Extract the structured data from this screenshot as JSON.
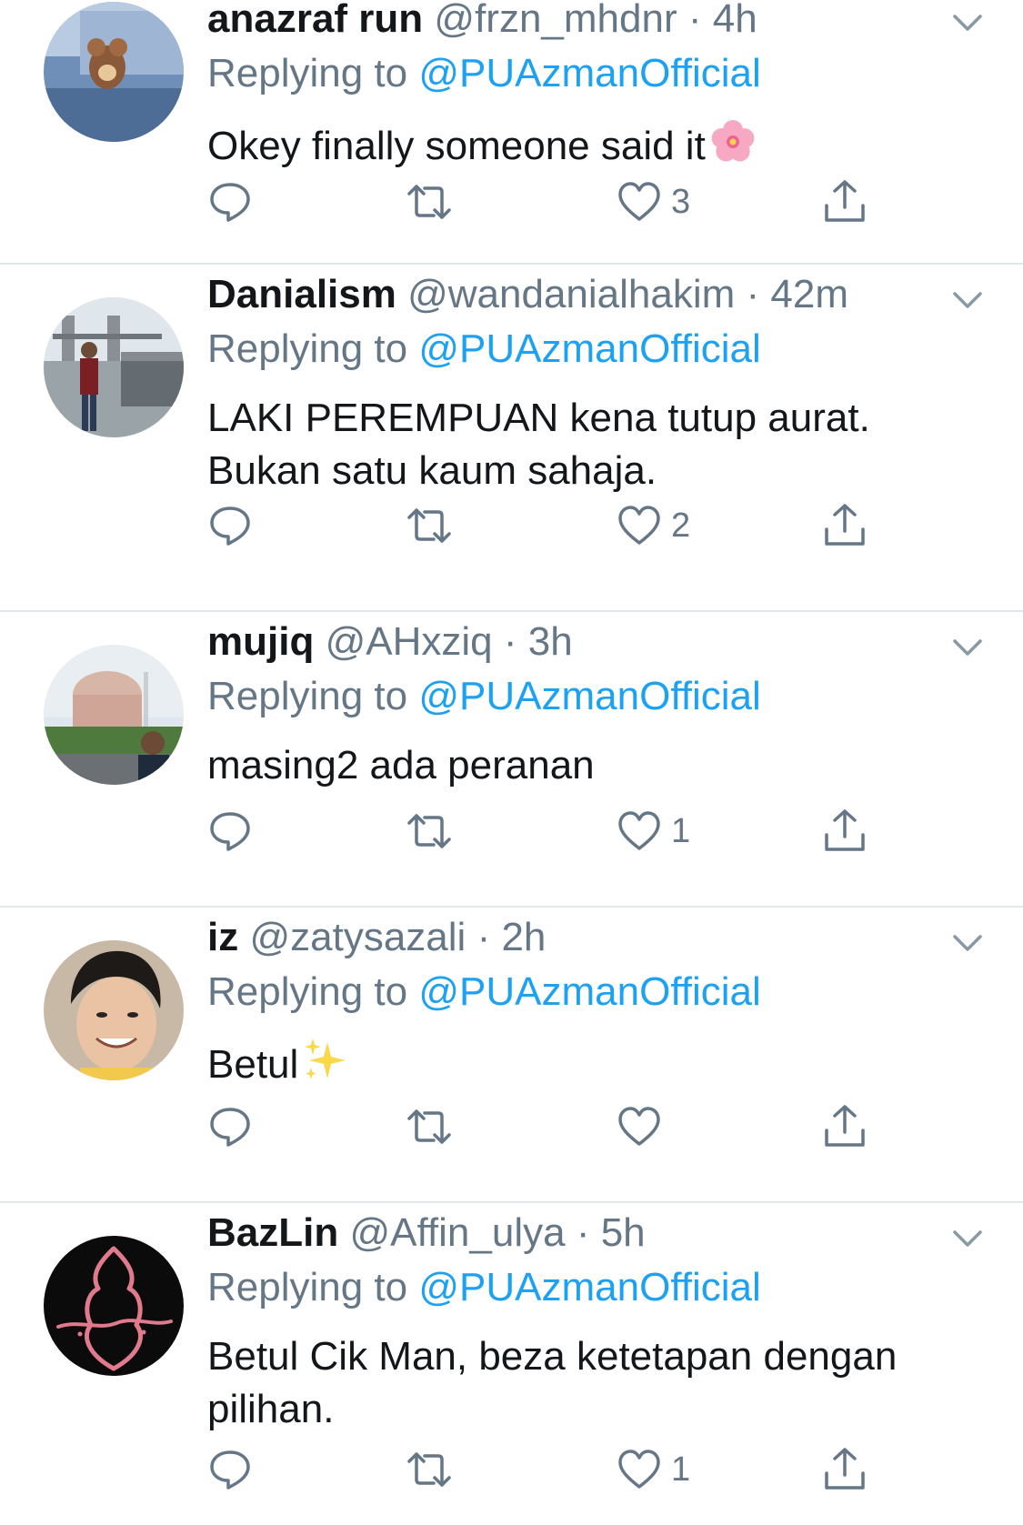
{
  "tweets": [
    {
      "name": "anazraf run",
      "handle": "@frzn_mhdnr",
      "separator": "·",
      "time": "4h",
      "replying_prefix": "Replying to ",
      "replying_to": "@PUAzmanOfficial",
      "text": "Okey finally someone said it",
      "emoji": "cherry-blossom",
      "likes": "3"
    },
    {
      "name": "Danialism",
      "handle": "@wandanialhakim",
      "separator": "·",
      "time": "42m",
      "replying_prefix": "Replying to ",
      "replying_to": "@PUAzmanOfficial",
      "text": "LAKI PEREMPUAN kena tutup aurat. Bukan satu kaum sahaja.",
      "likes": "2"
    },
    {
      "name": "mujiq",
      "handle": "@AHxziq",
      "separator": "·",
      "time": "3h",
      "replying_prefix": "Replying to ",
      "replying_to": "@PUAzmanOfficial",
      "text": "masing2 ada peranan",
      "likes": "1"
    },
    {
      "name": "iz",
      "handle": "@zatysazali",
      "separator": "·",
      "time": "2h",
      "replying_prefix": "Replying to ",
      "replying_to": "@PUAzmanOfficial",
      "text": "Betul",
      "emoji": "sparkles",
      "likes": ""
    },
    {
      "name": "BazLin",
      "handle": "@Affin_ulya",
      "separator": "·",
      "time": "5h",
      "replying_prefix": "Replying to ",
      "replying_to": "@PUAzmanOfficial",
      "text": "Betul Cik Man, beza ketetapan dengan pilihan.",
      "likes": "1"
    }
  ],
  "colors": {
    "text": "#14171a",
    "secondary": "#657786",
    "link": "#1da1f2",
    "divider": "#e1e8ed"
  },
  "icons": [
    "reply-icon",
    "retweet-icon",
    "like-icon",
    "share-icon",
    "caret-down-icon"
  ]
}
